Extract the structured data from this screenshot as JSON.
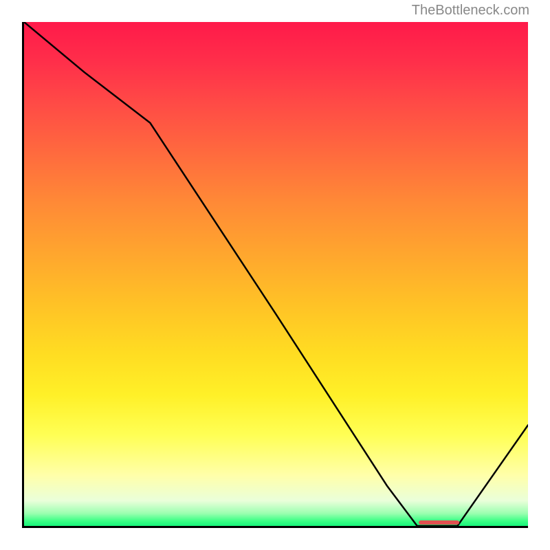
{
  "watermark": "TheBottleneck.com",
  "chart_data": {
    "type": "line",
    "title": "",
    "xlabel": "",
    "ylabel": "",
    "xlim": [
      0,
      100
    ],
    "ylim": [
      0,
      100
    ],
    "series": [
      {
        "name": "bottleneck-curve",
        "x": [
          0,
          12,
          25,
          50,
          72,
          78,
          86,
          100
        ],
        "values": [
          100,
          90,
          80,
          42,
          8,
          0,
          0,
          20
        ]
      }
    ],
    "optimal_range": {
      "start": 78,
      "end": 86
    },
    "gradient_stops": [
      {
        "pos": 0,
        "color": "#ff1a4a"
      },
      {
        "pos": 50,
        "color": "#ffc020"
      },
      {
        "pos": 82,
        "color": "#ffff55"
      },
      {
        "pos": 100,
        "color": "#18f57a"
      }
    ]
  }
}
